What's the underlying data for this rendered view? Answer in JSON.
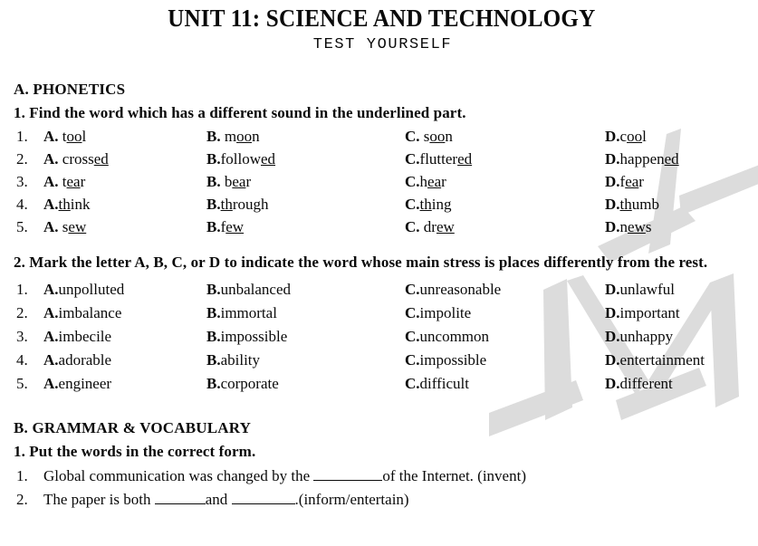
{
  "document": {
    "title": "UNIT 11: SCIENCE AND TECHNOLOGY",
    "subtitle": "TEST YOURSELF"
  },
  "sections": {
    "phonetics": {
      "heading": "A. PHONETICS",
      "q1": {
        "instruction": "1. Find  the word which has a different sound  in  the underlined  part.",
        "rows": [
          {
            "num": "1.",
            "a_label": "A.",
            "a_pre": " t",
            "a_u": "oo",
            "a_post": "l",
            "b_label": "B.",
            "b_pre": " m",
            "b_u": "oo",
            "b_post": "n",
            "c_label": "C.",
            "c_pre": " s",
            "c_u": "oo",
            "c_post": "n",
            "d_label": "D.",
            "d_pre": "c",
            "d_u": "oo",
            "d_post": "l"
          },
          {
            "num": "2.",
            "a_label": "A.",
            "a_pre": " cross",
            "a_u": "ed",
            "a_post": "",
            "b_label": "B.",
            "b_pre": "follow",
            "b_u": "ed",
            "b_post": "",
            "c_label": "C.",
            "c_pre": "flutter",
            "c_u": "ed",
            "c_post": "",
            "d_label": "D.",
            "d_pre": "happen",
            "d_u": "ed",
            "d_post": ""
          },
          {
            "num": "3.",
            "a_label": "A.",
            "a_pre": " t",
            "a_u": "ea",
            "a_post": "r",
            "b_label": "B.",
            "b_pre": " b",
            "b_u": "ea",
            "b_post": "r",
            "c_label": "C.",
            "c_pre": "h",
            "c_u": "ea",
            "c_post": "r",
            "d_label": "D.",
            "d_pre": "f",
            "d_u": "ea",
            "d_post": "r"
          },
          {
            "num": "4.",
            "a_label": "A.",
            "a_pre": "",
            "a_u": "th",
            "a_post": "ink",
            "b_label": "B.",
            "b_pre": "",
            "b_u": "th",
            "b_post": "rough",
            "c_label": "C.",
            "c_pre": "",
            "c_u": "th",
            "c_post": "ing",
            "d_label": "D.",
            "d_pre": "",
            "d_u": "th",
            "d_post": "umb"
          },
          {
            "num": "5.",
            "a_label": "A.",
            "a_pre": " s",
            "a_u": "ew",
            "a_post": "",
            "b_label": "B.",
            "b_pre": "f",
            "b_u": "ew",
            "b_post": "",
            "c_label": "C.",
            "c_pre": " dr",
            "c_u": "ew",
            "c_post": "",
            "d_label": "D.",
            "d_pre": "n",
            "d_u": "ew",
            "d_post": "s"
          }
        ]
      },
      "q2": {
        "instruction": "2. Mark the letter A, B, C, or D to indicate the word whose main stress is places differently from the rest.",
        "rows": [
          {
            "num": "1.",
            "a_label": "A.",
            "a_text": "unpolluted",
            "b_label": "B.",
            "b_text": "unbalanced",
            "c_label": "C.",
            "c_text": "unreasonable",
            "d_label": "D.",
            "d_text": "unlawful"
          },
          {
            "num": "2.",
            "a_label": "A.",
            "a_text": "imbalance",
            "b_label": "B.",
            "b_text": "immortal",
            "c_label": "C.",
            "c_text": "impolite",
            "d_label": "D.",
            "d_text": "important"
          },
          {
            "num": "3.",
            "a_label": "A.",
            "a_text": "imbecile",
            "b_label": "B.",
            "b_text": "impossible",
            "c_label": "C.",
            "c_text": "uncommon",
            "d_label": "D.",
            "d_text": "unhappy"
          },
          {
            "num": "4.",
            "a_label": "A.",
            "a_text": "adorable",
            "b_label": "B.",
            "b_text": "ability",
            "c_label": "C.",
            "c_text": "impossible",
            "d_label": "D.",
            "d_text": "entertainment"
          },
          {
            "num": "5.",
            "a_label": "A.",
            "a_text": "engineer",
            "b_label": "B.",
            "b_text": "corporate",
            "c_label": "C.",
            "c_text": "difficult",
            "d_label": "D.",
            "d_text": "different"
          }
        ]
      }
    },
    "grammar": {
      "heading": "B. GRAMMAR & VOCABULARY",
      "q1": {
        "instruction": "1. Put the words in the correct form.",
        "items": [
          {
            "num": "1.",
            "pre": "Global communication was changed by the ",
            "mid": "of the Internet. (invent)",
            "post": ""
          },
          {
            "num": "2.",
            "pre": "The paper is both ",
            "mid": "and ",
            "post": ".(inform/entertain)"
          }
        ]
      }
    }
  },
  "watermark": {
    "color": "#dcdcdc",
    "label": "MA"
  }
}
